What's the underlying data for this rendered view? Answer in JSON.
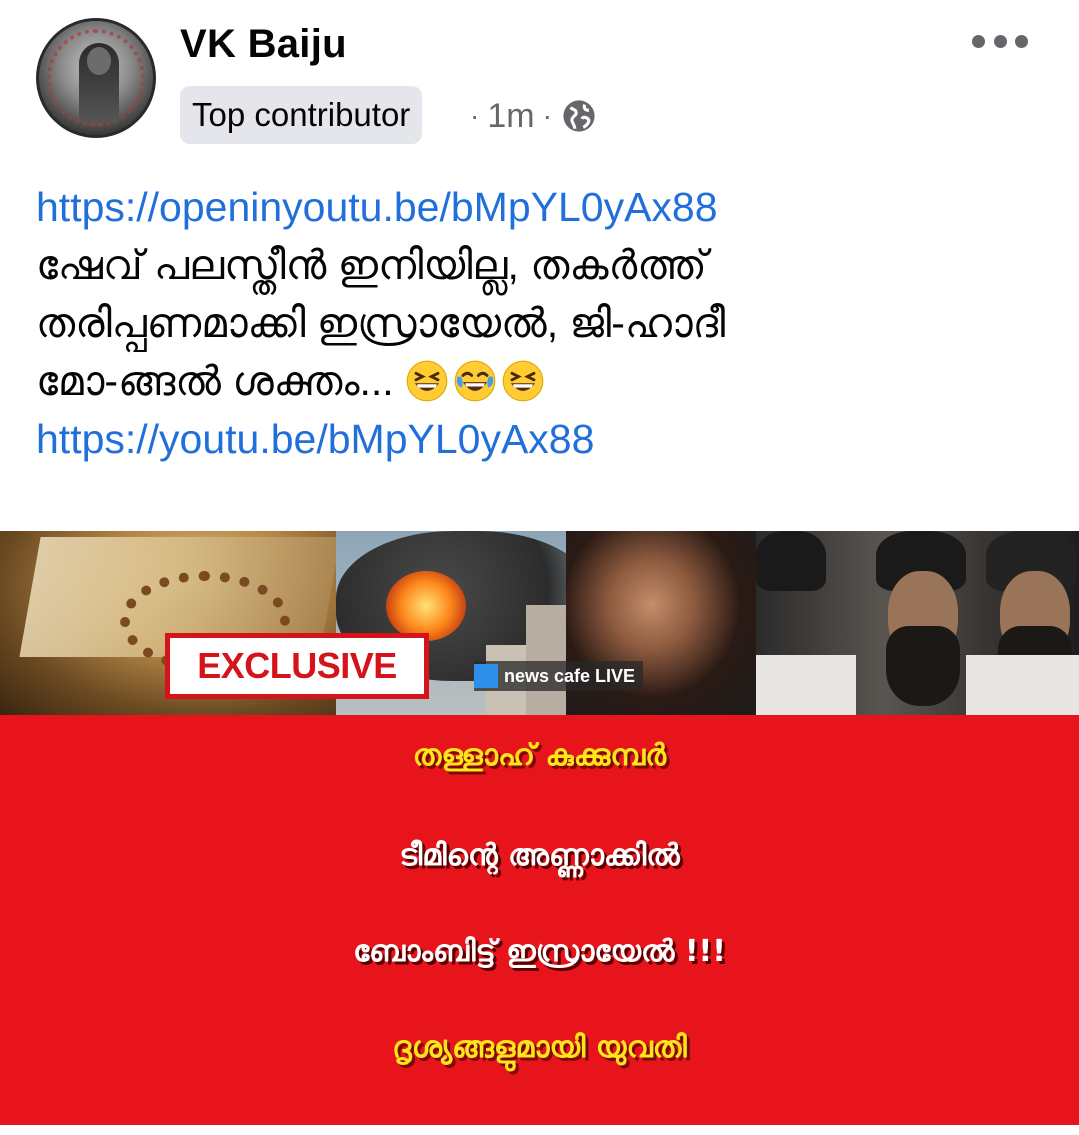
{
  "post": {
    "author": "VK Baiju",
    "badge": "Top contributor",
    "time": "1m",
    "separator": "·",
    "privacy_icon": "globe-icon",
    "more_icon": "more-options-icon",
    "link_1": "https://openinyoutu.be/bMpYL0yAx88",
    "text_line_1": "ഷേവ് പലസ്തീൻ ഇനിയില്ല, തകർത്ത്",
    "text_line_2": "തരിപ്പണമാക്കി ഇസ്രായേൽ, ജി-ഹാദീ",
    "text_line_3": "മോ-ങ്ങൽ ശക്തം...",
    "emojis": [
      "grinning-squinting-face",
      "face-with-tears-of-joy",
      "grinning-squinting-face"
    ],
    "link_2": "https://youtu.be/bMpYL0yAx88"
  },
  "image": {
    "exclusive_label": "EXCLUSIVE",
    "channel_label": "news cafe LIVE",
    "headline_1": "തള്ളാഹ് കുക്കുമ്പർ",
    "headline_2": "ടീമിന്റെ അണ്ണാക്കിൽ",
    "headline_3": "ബോംബിട്ട് ഇസ്രായേൽ !!!",
    "headline_4": "ദൃശ്യങ്ങളുമായി യുവതി",
    "colors": {
      "panel_red": "#e8141b",
      "headline_yellow": "#ffe61a",
      "headline_white": "#ffffff",
      "link_blue": "#216fdb"
    }
  }
}
